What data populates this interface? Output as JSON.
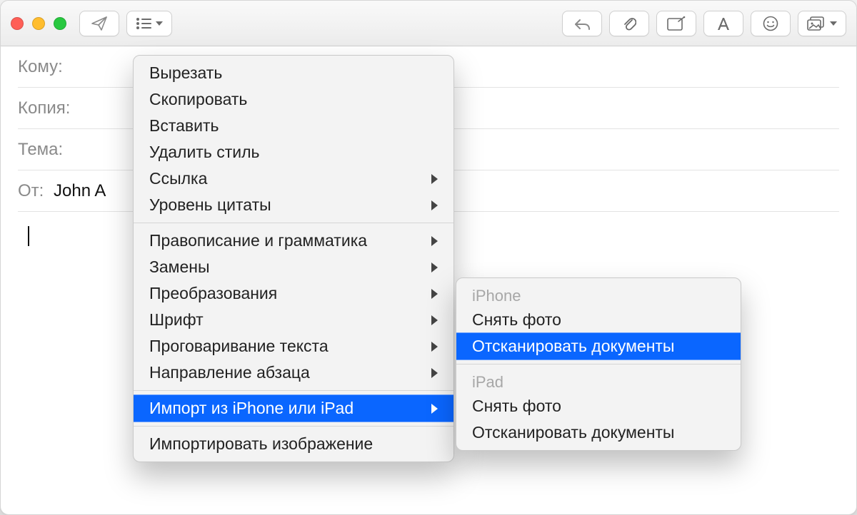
{
  "fields": {
    "to_label": "Кому:",
    "cc_label": "Копия:",
    "subject_label": "Тема:",
    "from_label": "От:",
    "from_value": "John A"
  },
  "context_menu": {
    "cut": "Вырезать",
    "copy": "Скопировать",
    "paste": "Вставить",
    "remove_style": "Удалить стиль",
    "link": "Ссылка",
    "quote_level": "Уровень цитаты",
    "spelling": "Правописание и грамматика",
    "substitutions": "Замены",
    "transformations": "Преобразования",
    "font": "Шрифт",
    "speech": "Проговаривание текста",
    "paragraph_direction": "Направление абзаца",
    "import_from_device": "Импорт из iPhone или iPad",
    "import_image": "Импортировать изображение"
  },
  "submenu": {
    "iphone_header": "iPhone",
    "take_photo_1": "Снять фото",
    "scan_docs_1": "Отсканировать документы",
    "ipad_header": "iPad",
    "take_photo_2": "Снять фото",
    "scan_docs_2": "Отсканировать документы"
  }
}
